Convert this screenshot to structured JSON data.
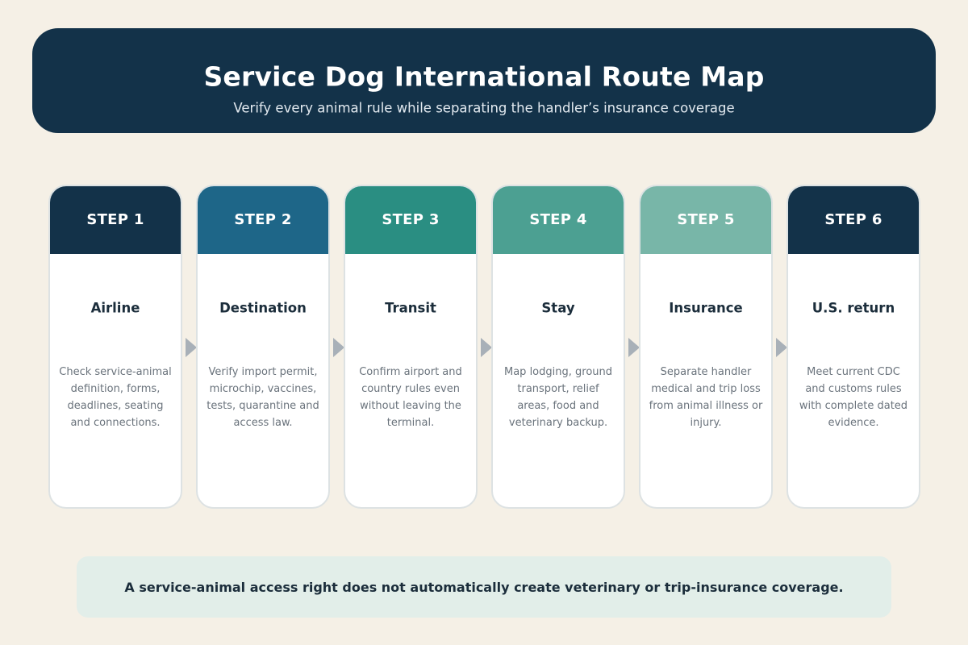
{
  "header": {
    "title": "Service Dog International Route Map",
    "subtitle": "Verify every animal rule while separating the handler’s insurance coverage"
  },
  "steps": [
    {
      "label": "STEP 1",
      "title": "Airline",
      "description": "Check service-animal definition, forms, deadlines, seating and connections.",
      "color": "#133249"
    },
    {
      "label": "STEP 2",
      "title": "Destination",
      "description": "Verify import permit, microchip, vaccines, tests, quarantine and access law.",
      "color": "#1e6688"
    },
    {
      "label": "STEP 3",
      "title": "Transit",
      "description": "Confirm airport and country rules even without leaving the terminal.",
      "color": "#2a8e82"
    },
    {
      "label": "STEP 4",
      "title": "Stay",
      "description": "Map lodging, ground transport, relief areas, food and veterinary backup.",
      "color": "#4ca092"
    },
    {
      "label": "STEP 5",
      "title": "Insurance",
      "description": "Separate handler medical and trip loss from animal illness or injury.",
      "color": "#78b6a8"
    },
    {
      "label": "STEP 6",
      "title": "U.S. return",
      "description": "Meet current CDC and customs rules with complete dated evidence.",
      "color": "#133249"
    }
  ],
  "footer": {
    "note": "A service-animal access right does not automatically create veterinary or trip-insurance coverage."
  }
}
